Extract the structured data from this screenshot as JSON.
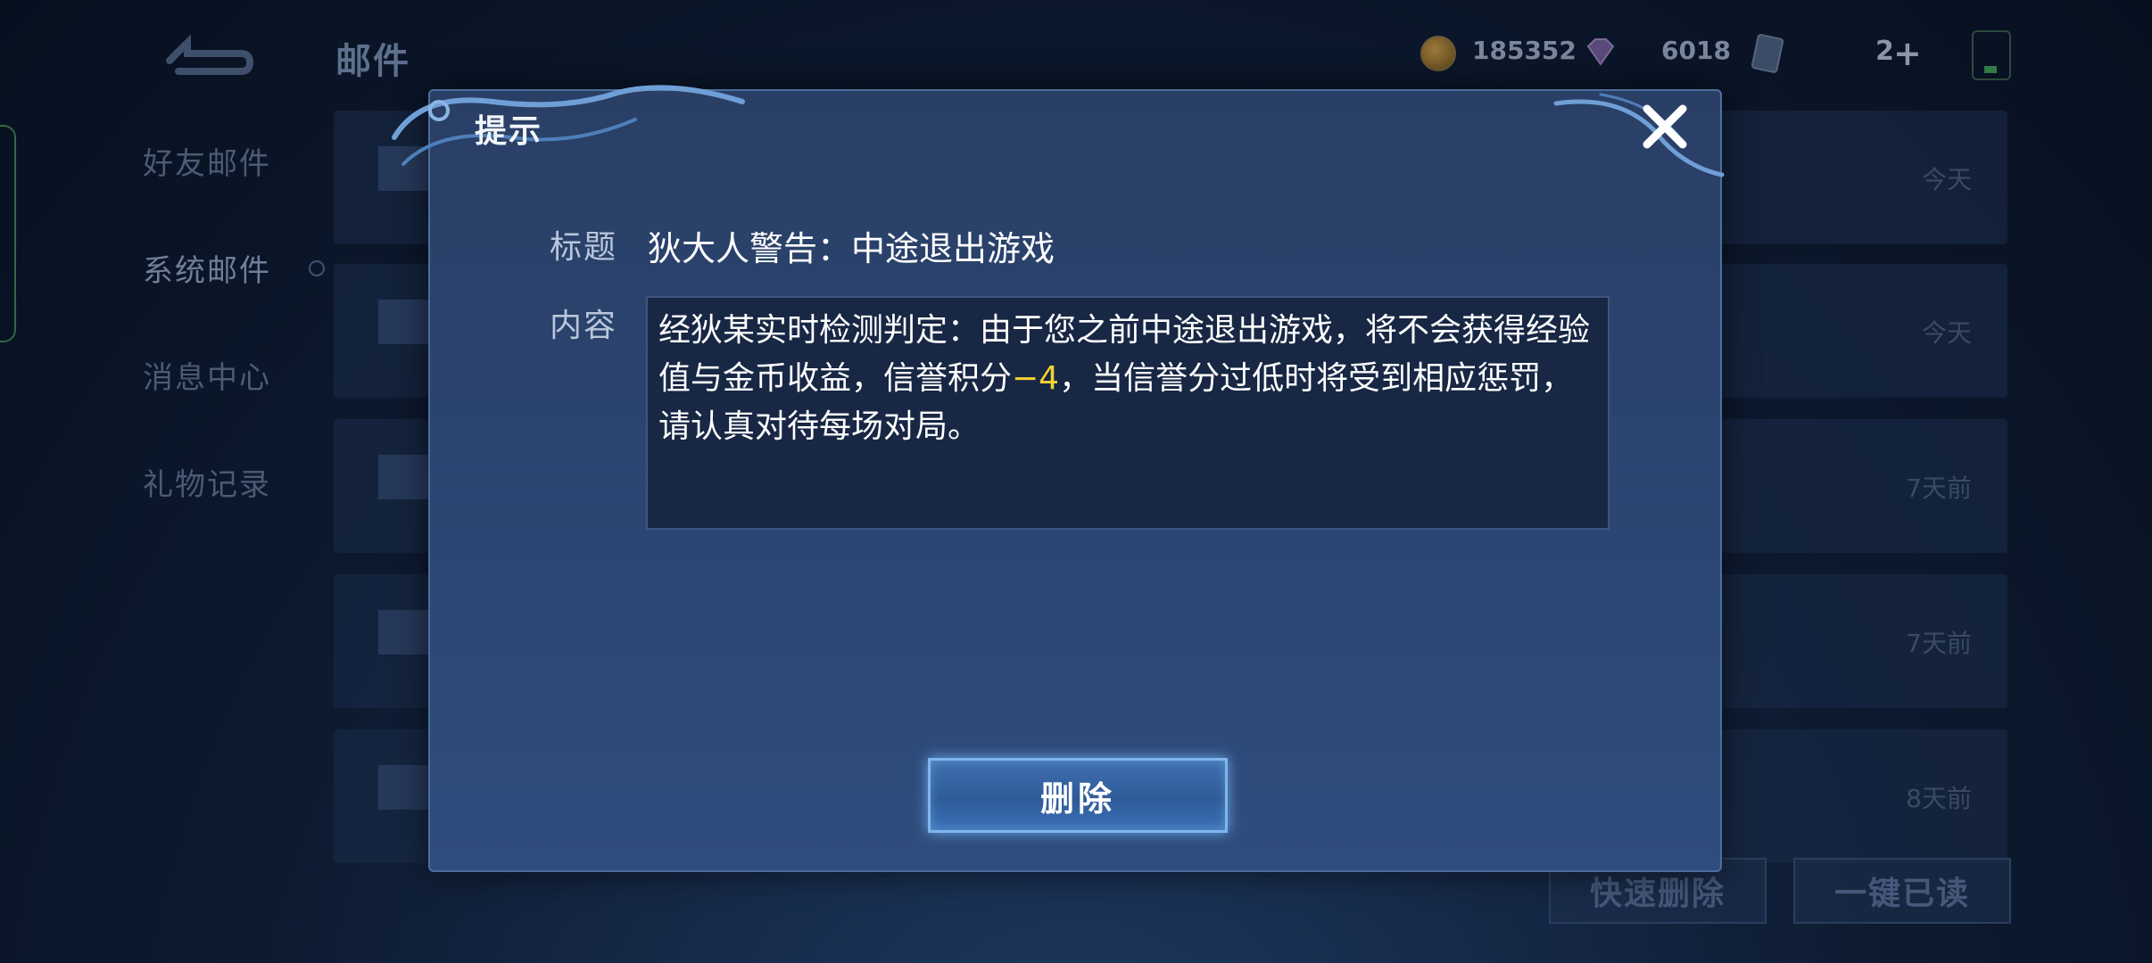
{
  "header": {
    "title": "邮件",
    "gold": "185352",
    "diamonds": "6018",
    "energy": "2"
  },
  "sidebar": {
    "items": [
      {
        "label": "好友邮件"
      },
      {
        "label": "系统邮件"
      },
      {
        "label": "消息中心"
      },
      {
        "label": "礼物记录"
      }
    ]
  },
  "mail_list": {
    "times": [
      "今天",
      "今天",
      "7天前",
      "7天前",
      "8天前"
    ]
  },
  "footer": {
    "quick_delete": "快速删除",
    "mark_all_read": "一键已读"
  },
  "dialog": {
    "title": "提示",
    "subject_label": "标题",
    "subject": "狄大人警告：中途退出游戏",
    "content_label": "内容",
    "content_part1": "经狄某实时检测判定：由于您之前中途退出游戏，将不会获得经验值与金币收益，信誉积分",
    "content_highlight": "−4",
    "content_part2": "，当信誉分过低时将受到相应惩罚，请认真对待每场对局。",
    "delete_label": "删除"
  },
  "colors": {
    "highlight": "#f3d232",
    "dialog_bg": "#2b4470",
    "accent_border": "#7fb6ec"
  }
}
